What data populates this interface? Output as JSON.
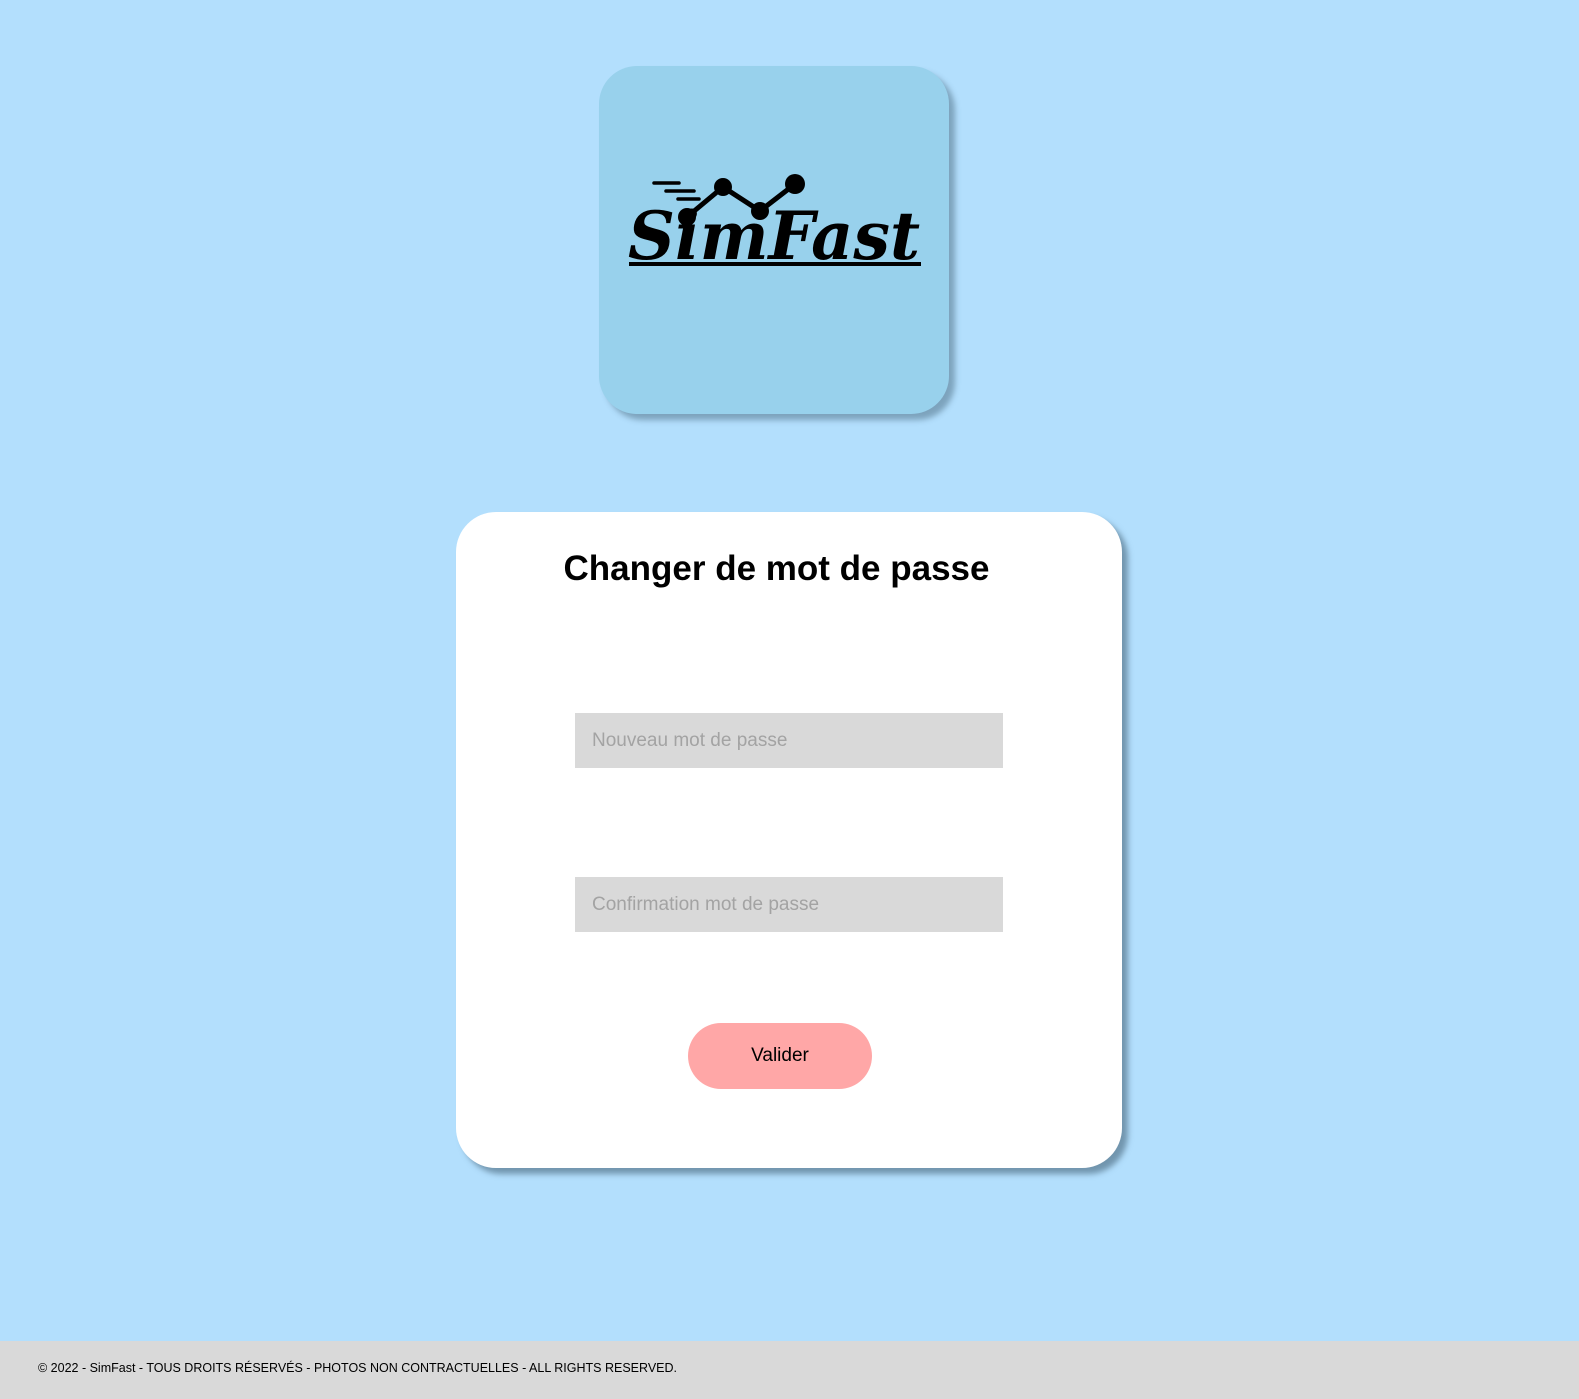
{
  "brand": {
    "logo_text": "SimFast",
    "tile_color": "#98d1ec",
    "logo_icon": "line-chart-icon"
  },
  "form": {
    "title": "Changer de mot de passe",
    "new_password_placeholder": "Nouveau mot de passe",
    "new_password_value": "",
    "confirm_password_placeholder": "Confirmation mot de passe",
    "confirm_password_value": "",
    "submit_label": "Valider"
  },
  "footer": {
    "text": "© 2022 - SimFast - TOUS DROITS RÉSERVÉS - PHOTOS NON CONTRACTUELLES - ALL RIGHTS RESERVED."
  },
  "colors": {
    "page_background": "#b3dffd",
    "card_background": "#ffffff",
    "input_background": "#d9d9d9",
    "button_background": "#ffa7a7",
    "footer_background": "#d9d9d9"
  }
}
